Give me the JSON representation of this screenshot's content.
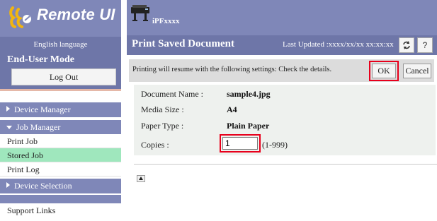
{
  "brand": {
    "title": "Remote UI"
  },
  "sidebar": {
    "language": "English language",
    "mode": "End-User Mode",
    "logout_label": "Log Out",
    "sections": {
      "device_manager": "Device Manager",
      "job_manager": "Job Manager",
      "device_selection": "Device Selection"
    },
    "job_items": [
      "Print Job",
      "Stored Job",
      "Print Log"
    ],
    "support_links": "Support Links"
  },
  "header": {
    "printer_name": "iPFxxxx",
    "page_title": "Print Saved Document",
    "last_updated": "Last Updated :xxxx/xx/xx xx:xx:xx"
  },
  "notice": {
    "text": "Printing will resume with the following settings: Check the details.",
    "ok_label": "OK",
    "cancel_label": "Cancel"
  },
  "details": {
    "document_name_label": "Document Name :",
    "document_name": "sample4.jpg",
    "media_size_label": "Media Size :",
    "media_size": "A4",
    "paper_type_label": "Paper Type :",
    "paper_type": "Plain Paper",
    "copies_label": "Copies :",
    "copies_value": "1",
    "copies_range": "(1-999)"
  },
  "colors": {
    "brand_bar": "#7f87b8",
    "title_bar": "#6e76a8",
    "active_nav": "#9fe7bd",
    "highlight": "#e8001c"
  }
}
